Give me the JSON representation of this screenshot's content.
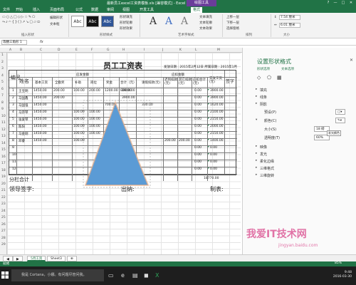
{
  "window": {
    "title": "最新员工excel工资表模板.xls [兼容模式] - Excel",
    "context_tab": "绘图工具",
    "buttons": [
      "?",
      "—",
      "□",
      "✕"
    ]
  },
  "ribbon_tabs": [
    "文件",
    "开始",
    "插入",
    "页面布局",
    "公式",
    "数据",
    "审阅",
    "视图",
    "开发工具",
    "格式"
  ],
  "active_tab": "格式",
  "ribbon": {
    "insert_shapes": {
      "label": "插入形状",
      "shapes_glyphs": "▭○△□◇▷☆✎⬠ ⤳⤴⌒{}()↗↘▢▱⬭",
      "edit_shape": "编辑形状",
      "text_box": "文本框"
    },
    "shape_styles": {
      "label": "形状样式",
      "samples": [
        "Abc",
        "Abc",
        "Abc"
      ],
      "fill": "形状填充",
      "outline": "形状轮廓",
      "effects": "形状效果"
    },
    "wordart": {
      "label": "艺术字样式",
      "samples": [
        "A",
        "A",
        "A"
      ],
      "text_fill": "文本填充",
      "text_outline": "文本轮廓",
      "text_effects": "文本效果"
    },
    "arrange": {
      "label": "排列",
      "bring_forward": "上移一层",
      "send_backward": "下移一层",
      "selection_pane": "选择窗格"
    },
    "size": {
      "label": "大小",
      "height": "7.54 厘米",
      "width": "6.01 厘米"
    }
  },
  "formula_bar": {
    "name_box": "等腰三角形 1",
    "fx": "fx",
    "content": ""
  },
  "columns": [
    "A",
    "B",
    "C",
    "D",
    "E",
    "F",
    "G",
    "H",
    "I",
    "J",
    "K",
    "L",
    "M"
  ],
  "rows": [
    "1",
    "2",
    "3",
    "4",
    "5",
    "6",
    "7",
    "8",
    "9",
    "10",
    "11",
    "12",
    "13",
    "14",
    "15",
    "16",
    "17",
    "18",
    "19",
    "20",
    "21",
    "22",
    "23",
    "24",
    "25",
    "26",
    "27",
    "28",
    "29"
  ],
  "sheet": {
    "title": "员工工资表",
    "meta": "发放日期 : 2015年2月12日  所属日期 : 2015年1月",
    "header": {
      "no": "编号",
      "name": "姓名",
      "should_pay": "应发金额",
      "should_deduct": "应扣金额",
      "cols": [
        "基本工资",
        "全勤奖",
        "补助",
        "岗位",
        "奖金",
        "合计（元）",
        "请假扣款(元)",
        "迟到扣款(元)",
        "其它扣款(元)",
        "应扣合计(元)",
        "实发工资(元)",
        "签字"
      ]
    },
    "data_rows": [
      {
        "no": "1",
        "name": "王宝明",
        "v": [
          "1450.00",
          "200.00",
          "100.00",
          "200.00",
          "1200.00",
          "800.00",
          "3900.00"
        ],
        "net": "3900.00"
      },
      {
        "no": "2",
        "name": "马国鑫",
        "v": [
          "1450.00",
          "200.00",
          "",
          "",
          "",
          "",
          "3900.00"
        ],
        "net": "3900.00"
      },
      {
        "no": "3",
        "name": "马国强",
        "v": [
          "1450.00",
          "",
          "",
          "",
          "700.00",
          "",
          ""
        ],
        "dk": "330.00",
        "net": "1620.00"
      },
      {
        "no": "4",
        "name": "马宗琴",
        "v": [
          "1450.00",
          "",
          "100.00",
          "100.00",
          "",
          "",
          ""
        ],
        "net": "2100.00"
      },
      {
        "no": "5",
        "name": "张爱琴",
        "v": [
          "1450.00",
          "",
          "100.00",
          "100.00",
          "",
          "",
          ""
        ],
        "net": "2150.00"
      },
      {
        "no": "6",
        "name": "陈阳",
        "v": [
          "1450.00",
          "",
          "100.00",
          "100.00",
          "",
          "",
          ""
        ],
        "net": "2000.00"
      },
      {
        "no": "7",
        "name": "马金刚",
        "v": [
          "1450.00",
          "",
          "100.00",
          "100.00",
          "",
          "",
          ""
        ],
        "net": "2150.00"
      },
      {
        "no": "8",
        "name": "邓睿",
        "v": [
          "1450.00",
          "",
          "100.00",
          "",
          "",
          "",
          ""
        ],
        "qk": "200.00",
        "dk": "200.00",
        "net": "1400.00"
      },
      {
        "no": "9",
        "name": "",
        "v": [],
        "net": "0.00"
      },
      {
        "no": "10",
        "name": "",
        "v": [],
        "net": "0.00"
      },
      {
        "no": "11",
        "name": "",
        "v": [],
        "net": "0.00"
      },
      {
        "no": "12",
        "name": "",
        "v": [],
        "net": "0.00"
      }
    ],
    "zero": "0.00",
    "total_label": "分栏合计",
    "total_value": "18770.00",
    "footer": {
      "leader": "领导签字:",
      "cashier": "出纳:",
      "maker": "制表:"
    }
  },
  "pane": {
    "title": "设置形状格式",
    "subtabs": [
      "形状选项",
      "文本选项"
    ],
    "sections": [
      "填充",
      "线条",
      "阴影",
      "预设(P)",
      "颜色(C)",
      "大小(S)",
      "透明度(T)",
      "映像",
      "发光",
      "柔化边缘",
      "三维格式",
      "三维旋转"
    ],
    "size_value": "18 磅",
    "transparency_value": "60%",
    "tooltip": "发光颜色"
  },
  "sheet_tabs": [
    "5月工资",
    "Sheet3"
  ],
  "statusbar": {
    "left": "就绪",
    "zoom": "85%"
  },
  "taskbar": {
    "search": "我是 Cortana，小娜。有问题尽管问我。",
    "time": "9:48",
    "date": "2016-03-30"
  },
  "watermark": {
    "text": "我爱IT技术网",
    "url": "jingyan.baidu.com"
  },
  "colors": {
    "excel_green": "#217346",
    "triangle": "#5b9bd5",
    "context_purple": "#6a3d9a"
  }
}
